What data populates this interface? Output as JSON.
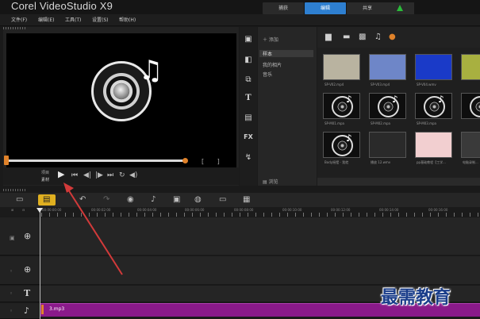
{
  "app": {
    "title": "Corel VideoStudio X9",
    "mode_tabs": [
      {
        "label": "捕获",
        "active": false
      },
      {
        "label": "编辑",
        "active": true
      },
      {
        "label": "共享",
        "active": false
      }
    ],
    "upload_icon": "upload-arrow-icon"
  },
  "menu": {
    "items": [
      "文件(F)",
      "编辑(E)",
      "工具(T)",
      "设置(S)",
      "帮助(H)"
    ]
  },
  "player": {
    "preview_icon": "speaker-music-icon",
    "mode_project": "项目",
    "mode_clip": "素材",
    "transport": {
      "play": "▶",
      "home": "⏮",
      "prev_frame": "◀|",
      "next_frame": "|▶",
      "end": "⏭",
      "repeat": "↻",
      "volume": "◀)"
    },
    "mark_in_out": "[ ]",
    "accent": "#e0822a"
  },
  "library": {
    "side_icons": [
      "media-icon",
      "instant-project-icon",
      "transition-icon",
      "title-icon",
      "graphic-icon",
      "fx-filter-icon",
      "path-icon"
    ],
    "side_labels": {
      "title": "T",
      "fx": "FX"
    },
    "add_label": "添加",
    "nav_items": [
      {
        "label": "样本",
        "selected": true
      },
      {
        "label": "我的相片",
        "selected": false
      },
      {
        "label": "音乐",
        "selected": false
      }
    ],
    "browse_label": "浏览",
    "thumbnails": [
      {
        "caption": "SP-V02.mp4",
        "kind": "video",
        "color": "#b9b3a0"
      },
      {
        "caption": "SP-V03.mp4",
        "kind": "video",
        "color": "#6e86c8"
      },
      {
        "caption": "SP-V04.wmv",
        "kind": "video",
        "color": "#1a3ac8"
      },
      {
        "caption": "",
        "kind": "video",
        "color": "#a8b040"
      },
      {
        "caption": "SP-M01.mpa",
        "kind": "music"
      },
      {
        "caption": "SP-M02.mpa",
        "kind": "music"
      },
      {
        "caption": "SP-M03.mpa",
        "kind": "music"
      },
      {
        "caption": "",
        "kind": "music"
      },
      {
        "caption": "Body摇摆 - 我就",
        "kind": "music"
      },
      {
        "caption": "播放 12.wmv",
        "kind": "video",
        "color": "#2a2a2a"
      },
      {
        "caption": "pp基础教程【工学...",
        "kind": "video",
        "color": "#f2cfd0"
      },
      {
        "caption": "电脑录制...",
        "kind": "video",
        "color": "#3a3a3a"
      }
    ]
  },
  "timeline": {
    "ruler_labels": [
      "00:00:00:00",
      "00:00:02:00",
      "00:00:04:00",
      "00:00:06:00",
      "00:00:08:00",
      "00:00:10:00",
      "00:00:12:00",
      "00:00:14:00",
      "00:00:16:00"
    ],
    "toolbar_icons": [
      "storyboard-view-icon",
      "timeline-view-icon",
      "undo-icon",
      "redo-icon",
      "record-capture-icon",
      "audio-mixer-icon",
      "auto-music-icon",
      "motion-tracking-icon",
      "subtitle-icon",
      "multi-camera-icon"
    ],
    "tracks": [
      {
        "name": "video-track",
        "icon": "video-track-icon"
      },
      {
        "name": "overlay-track",
        "icon": "overlay-track-icon"
      },
      {
        "name": "title-track",
        "icon": "title-track-icon"
      },
      {
        "name": "music-track",
        "icon": "music-track-icon"
      }
    ],
    "clip_label": "3.mp3",
    "clip_color": "#8a1a8a"
  },
  "watermark": "最需教育",
  "annotation_color": "#d23a3a"
}
